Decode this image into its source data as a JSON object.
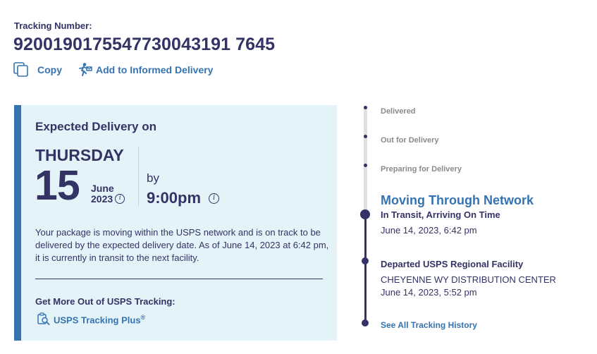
{
  "tracking": {
    "label": "Tracking Number:",
    "number": "9200190175547730043191 7645",
    "copy_label": "Copy",
    "informed_label": "Add to Informed Delivery"
  },
  "delivery": {
    "heading": "Expected Delivery on",
    "day": "THURSDAY",
    "date": "15",
    "month": "June",
    "year": "2023",
    "by": "by",
    "time": "9:00pm",
    "description": "Your package is moving within the USPS network and is on track to be delivered by the expected delivery date. As of June 14, 2023 at 6:42 pm, it is currently in transit to the next facility.",
    "more_heading": "Get More Out of USPS Tracking:",
    "plus_label": "USPS Tracking Plus",
    "plus_mark": "®"
  },
  "timeline": {
    "steps": [
      "Delivered",
      "Out for Delivery",
      "Preparing for Delivery"
    ],
    "current": {
      "title": "Moving Through Network",
      "status": "In Transit, Arriving On Time",
      "datetime": "June 14, 2023, 6:42 pm"
    },
    "previous": {
      "title": "Departed USPS Regional Facility",
      "location": "CHEYENNE WY DISTRIBUTION CENTER",
      "datetime": "June 14, 2023, 5:52 pm"
    },
    "history_label": "See All Tracking History"
  },
  "icons": {
    "copy": "copy-icon",
    "informed": "informed-delivery-icon",
    "info": "info-icon",
    "tracking_plus": "tracking-plus-icon"
  },
  "colors": {
    "navy": "#333366",
    "link_blue": "#3573b1",
    "card_bg": "#e4f3f7",
    "grey_text": "#8a8a8a"
  }
}
